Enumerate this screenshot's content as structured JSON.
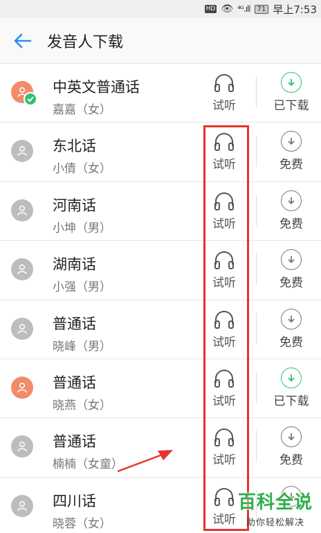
{
  "status_bar": {
    "hd": "HD",
    "signal": "⁴ᴳ.ıll",
    "battery": "71",
    "time": "早上7:53"
  },
  "header": {
    "title": "发音人下载",
    "back_icon": "arrow-left-icon"
  },
  "colors": {
    "accent_blue": "#2b8ef0",
    "download_green": "#2fbf71",
    "avatar_orange": "#f28b6a",
    "avatar_grey": "#bdbdbd",
    "highlight_red": "#e8322d"
  },
  "speakers": [
    {
      "name": "中英文普通话",
      "voice": "嘉嘉（女）",
      "listen": "试听",
      "action": "已下载",
      "downloaded": true
    },
    {
      "name": "东北话",
      "voice": "小倩（女）",
      "listen": "试听",
      "action": "免费",
      "downloaded": false
    },
    {
      "name": "河南话",
      "voice": "小坤（男）",
      "listen": "试听",
      "action": "免费",
      "downloaded": false
    },
    {
      "name": "湖南话",
      "voice": "小强（男）",
      "listen": "试听",
      "action": "免费",
      "downloaded": false
    },
    {
      "name": "普通话",
      "voice": "晓峰（男）",
      "listen": "试听",
      "action": "免费",
      "downloaded": false
    },
    {
      "name": "普通话",
      "voice": "晓燕（女）",
      "listen": "试听",
      "action": "已下载",
      "downloaded": true
    },
    {
      "name": "普通话",
      "voice": "楠楠（女童）",
      "listen": "试听",
      "action": "免费",
      "downloaded": false
    },
    {
      "name": "四川话",
      "voice": "晓蓉（女）",
      "listen": "试听",
      "action": "",
      "downloaded": false
    }
  ],
  "watermark": {
    "main": "百科全说",
    "sub": "助你轻松解决"
  }
}
